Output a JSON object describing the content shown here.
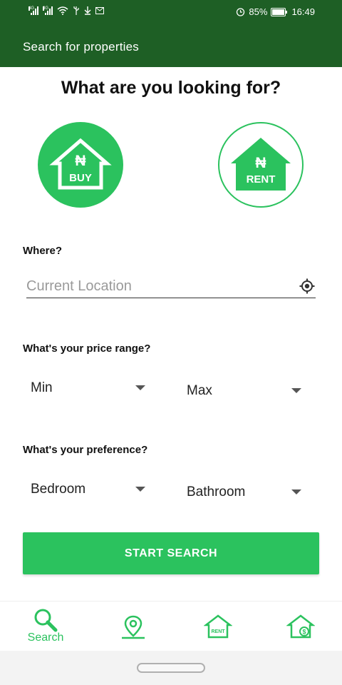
{
  "status_bar": {
    "network_1": "4G",
    "network_2": "3G",
    "battery_percent": "85%",
    "time": "16:49",
    "icons": [
      "signal-icon",
      "wifi-icon",
      "usb-icon",
      "download-icon",
      "mail-icon",
      "alarm-icon",
      "battery-icon"
    ]
  },
  "app_bar": {
    "title": "Search for properties"
  },
  "main": {
    "heading": "What are you looking for?",
    "buy": {
      "symbol": "₦",
      "label": "BUY"
    },
    "rent": {
      "symbol": "₦",
      "label": "RENT"
    },
    "where_label": "Where?",
    "location_placeholder": "Current Location",
    "price_label": "What's your price range?",
    "price_min": "Min",
    "price_max": "Max",
    "preference_label": "What's your preference?",
    "bedroom": "Bedroom",
    "bathroom": "Bathroom",
    "start_button": "START SEARCH"
  },
  "bottom_nav": {
    "search_label": "Search",
    "rent_icon_text": "RENT",
    "sale_icon_text": "$"
  },
  "colors": {
    "primary_dark": "#1e5f25",
    "accent": "#2bc25e"
  }
}
